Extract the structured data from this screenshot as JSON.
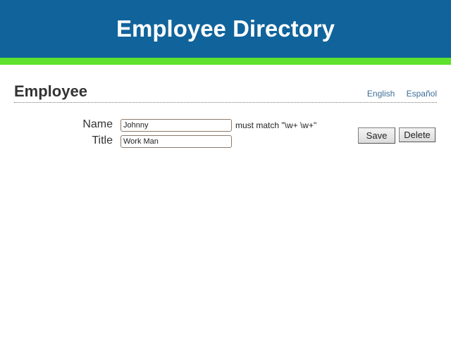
{
  "header": {
    "title": "Employee Directory"
  },
  "section": {
    "title": "Employee"
  },
  "languages": [
    "English",
    "Español"
  ],
  "form": {
    "name_label": "Name",
    "name_value": "Johnny",
    "name_hint": "must match \"\\w+ \\w+\"",
    "title_label": "Title",
    "title_value": "Work Man"
  },
  "actions": {
    "save_label": "Save",
    "delete_label": "Delete"
  },
  "colors": {
    "header_bg": "#10639b",
    "accent_bar": "#5ee22d",
    "link": "#3d6d98"
  }
}
